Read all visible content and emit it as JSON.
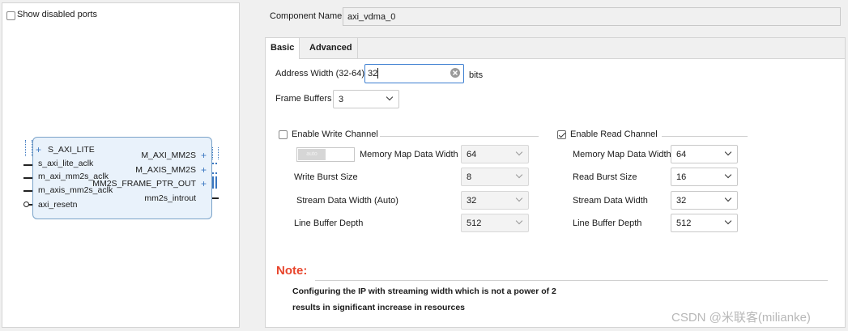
{
  "left_panel": {
    "show_disabled_label": "Show disabled ports",
    "block": {
      "ports_left": [
        "S_AXI_LITE",
        "s_axi_lite_aclk",
        "m_axi_mm2s_aclk",
        "m_axis_mm2s_aclk",
        "axi_resetn"
      ],
      "ports_right": [
        "M_AXI_MM2S",
        "M_AXIS_MM2S",
        "MM2S_FRAME_PTR_OUT",
        "mm2s_introut"
      ],
      "plus": "+"
    }
  },
  "component": {
    "label": "Component Name",
    "value": "axi_vdma_0"
  },
  "tabs": [
    {
      "label": "Basic"
    },
    {
      "label": "Advanced"
    }
  ],
  "basic": {
    "address_width": {
      "label": "Address Width (32-64)",
      "value": "32",
      "unit": "bits"
    },
    "frame_buffers": {
      "label": "Frame Buffers",
      "value": "3"
    },
    "write_channel": {
      "label": "Enable Write Channel",
      "checked": false,
      "toggle_text": "auto",
      "rows": [
        {
          "label": "Memory Map Data Width",
          "value": "64"
        },
        {
          "label": "Write Burst Size",
          "value": "8"
        },
        {
          "label": "Stream Data Width (Auto)",
          "value": "32"
        },
        {
          "label": "Line Buffer Depth",
          "value": "512"
        }
      ]
    },
    "read_channel": {
      "label": "Enable Read Channel",
      "checked": true,
      "rows": [
        {
          "label": "Memory Map Data Width",
          "value": "64"
        },
        {
          "label": "Read Burst Size",
          "value": "16"
        },
        {
          "label": "Stream Data Width",
          "value": "32"
        },
        {
          "label": "Line Buffer Depth",
          "value": "512"
        }
      ]
    },
    "note": {
      "title": "Note:",
      "line1": "Configuring the IP with streaming width which is not a power of 2",
      "line2": "results in significant increase in resources"
    }
  },
  "watermark": "CSDN @米联客(milianke)",
  "colors": {
    "note_title": "#e8452c",
    "focus_border": "#3d7fd1",
    "block_fill": "#e9f2fb"
  }
}
